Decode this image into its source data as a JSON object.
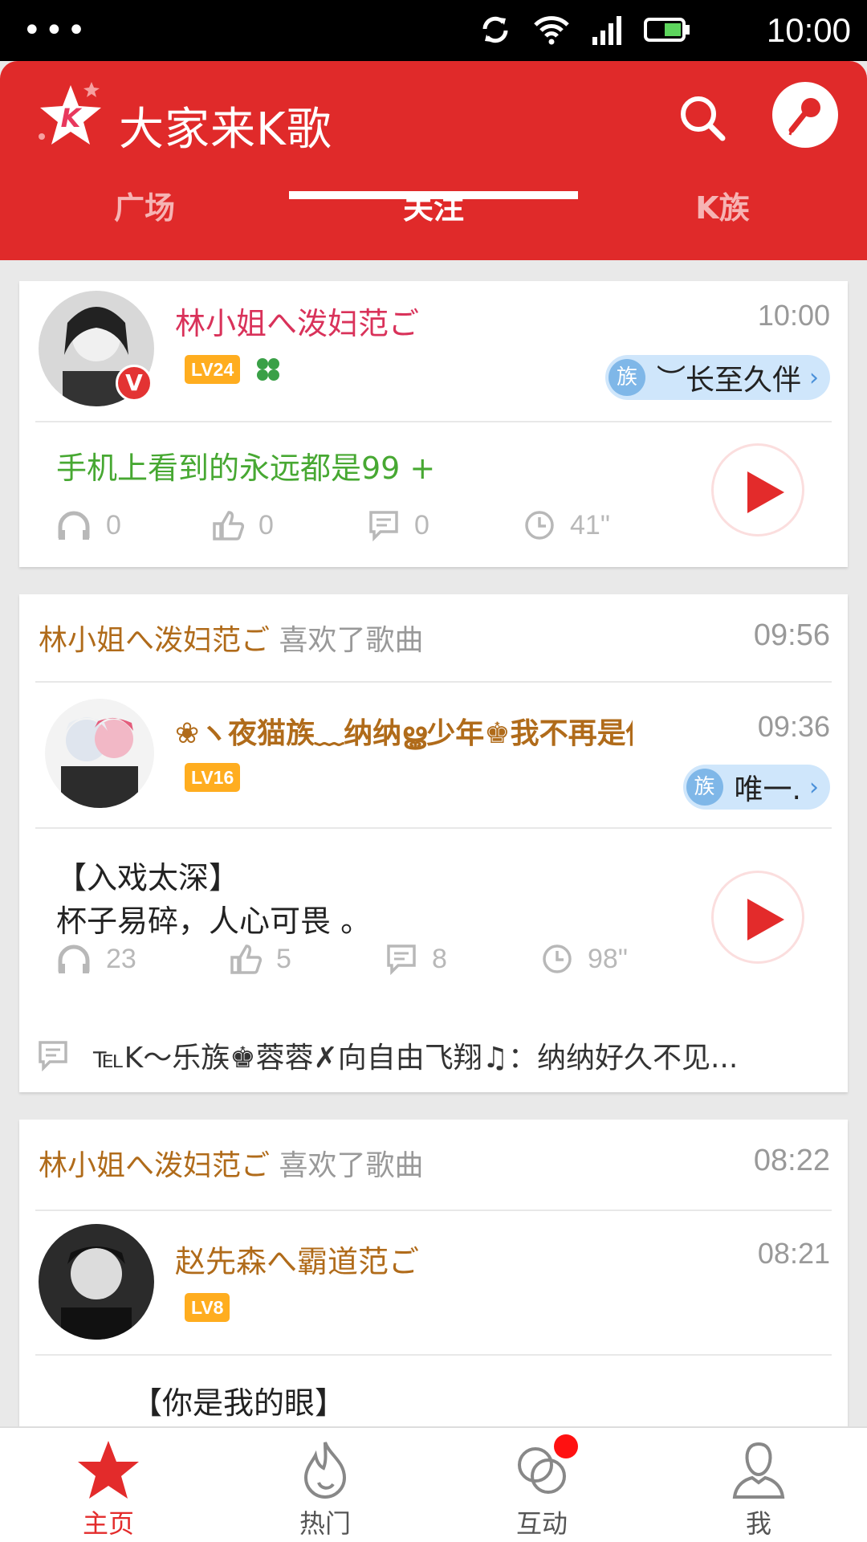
{
  "status_bar": {
    "time": "10:00"
  },
  "header": {
    "title": "大家来K歌"
  },
  "tabs": [
    {
      "label": "广场"
    },
    {
      "label": "关注"
    },
    {
      "label": "K族"
    }
  ],
  "feed": [
    {
      "user": "林小姐へ泼妇范ご",
      "time": "10:00",
      "level": "LV24",
      "clan": "︶长至久伴",
      "clan_badge": "族",
      "song_text": "手机上看到的永远都是99 +",
      "stats": {
        "listens": "0",
        "likes": "0",
        "comments": "0",
        "duration": "41\""
      }
    },
    {
      "liker": "林小姐へ泼妇范ご",
      "action": "喜欢了歌曲",
      "like_time": "09:56",
      "user": "❀ヽ夜猫族﹏纳纳ൠ少年♚我不再是你的...",
      "time": "09:36",
      "level": "LV16",
      "clan": "唯一.",
      "clan_badge": "族",
      "song_line1": "【入戏太深】",
      "song_line2": "杯子易碎，人心可畏 。",
      "stats": {
        "listens": "23",
        "likes": "5",
        "comments": "8",
        "duration": "98\""
      },
      "comment": "℡K～乐族♚蓉蓉✗向自由飞翔♫：纳纳好久不见..."
    },
    {
      "liker": "林小姐へ泼妇范ご",
      "action": "喜欢了歌曲",
      "like_time": "08:22",
      "user": "赵先森へ霸道范ご",
      "time": "08:21",
      "level": "LV8",
      "song_line1": "【你是我的眼】"
    }
  ],
  "bottom_nav": [
    {
      "label": "主页",
      "icon": "star-icon"
    },
    {
      "label": "热门",
      "icon": "flame-icon"
    },
    {
      "label": "互动",
      "icon": "rings-icon"
    },
    {
      "label": "我",
      "icon": "person-icon"
    }
  ],
  "colors": {
    "primary": "#e02a2a",
    "accent_name": "#b06b1a",
    "song_green": "#47a832",
    "level": "#ffad1f",
    "clan_pill": "#cfe6fb"
  }
}
